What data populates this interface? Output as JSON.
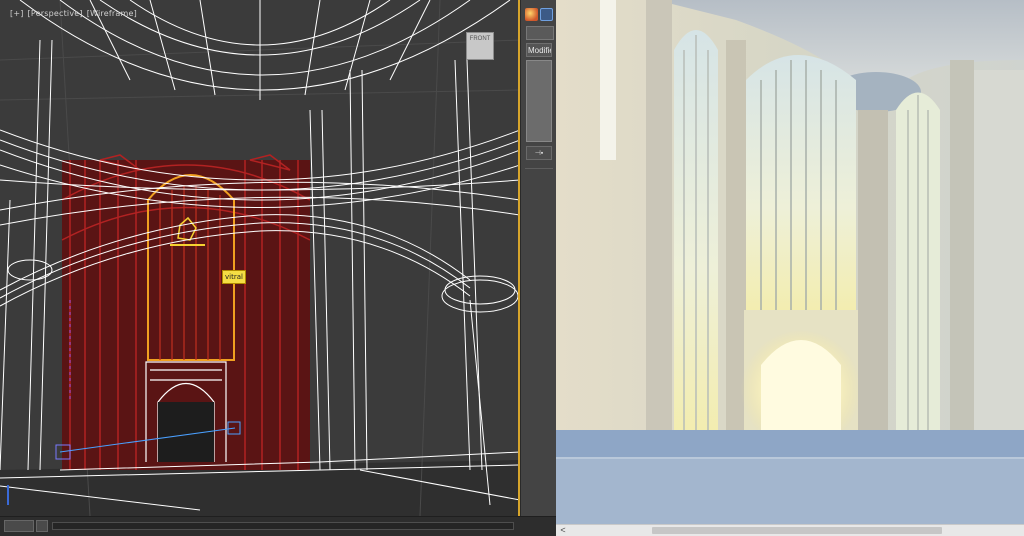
{
  "viewport": {
    "label_parts": [
      "[+]",
      "[Perspective]",
      "[Wireframe]"
    ],
    "selected_object_label": "vitral",
    "viewcube_face": "FRONT"
  },
  "command_panel": {
    "modifier_list_label": "Modifier",
    "pin_stack_icon": "pin-stack-icon"
  },
  "render_window": {
    "scroll_left_glyph": "<"
  },
  "icons": {
    "create_tab": "sphere-icon",
    "modify_tab": "modify-arc-icon",
    "viewcube": "viewcube-icon"
  },
  "colors": {
    "viewport_border": "#d7a52b",
    "wireframe": "#ffffff",
    "selection_red": "#8b1a1a",
    "selection_orange": "#f0a020",
    "tag_yellow": "#f5de44"
  }
}
